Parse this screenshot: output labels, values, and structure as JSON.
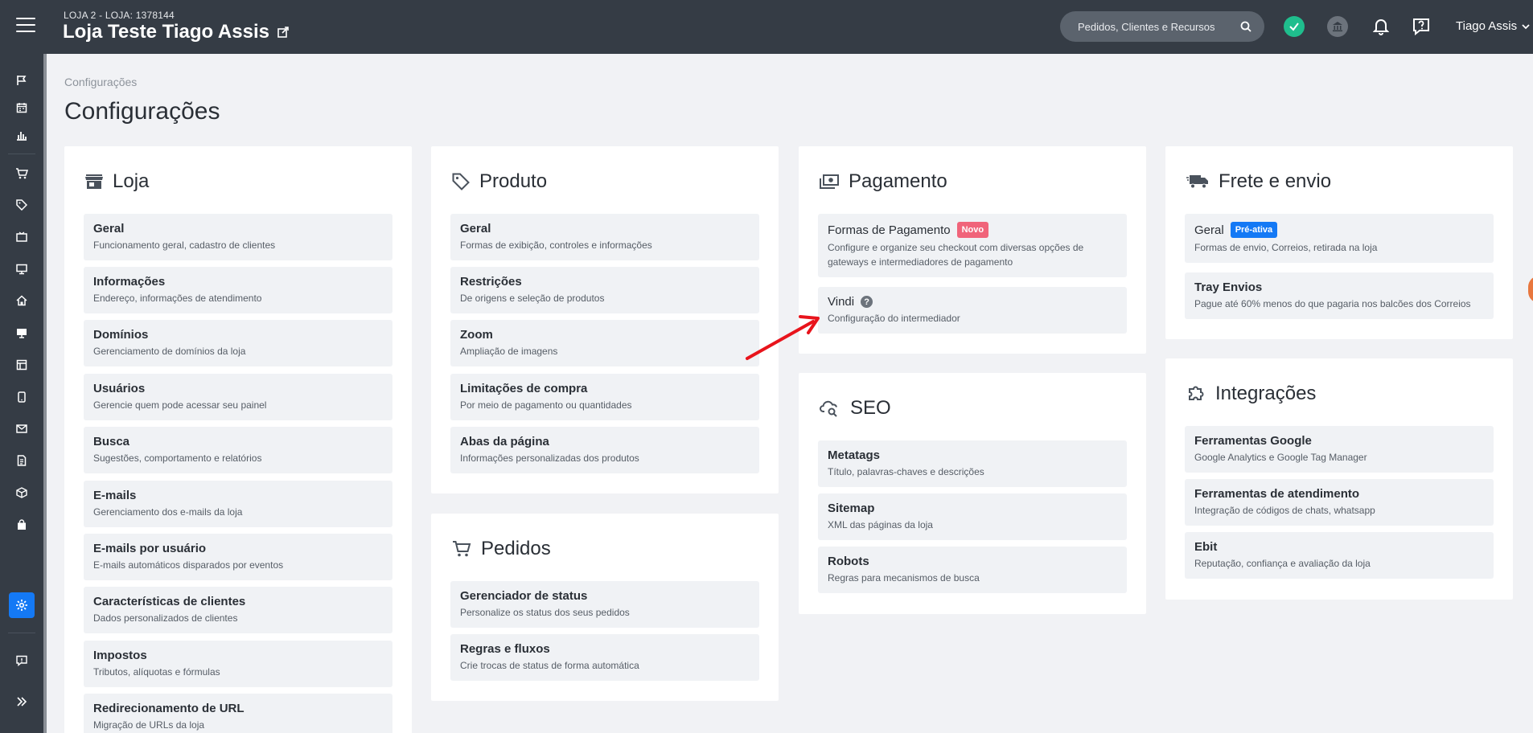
{
  "header": {
    "store_sub": "LOJA 2 - LOJA: 1378144",
    "store_title": "Loja Teste Tiago Assis",
    "search_placeholder": "Pedidos, Clientes e Recursos",
    "user_name": "Tiago Assis"
  },
  "sidebar": {
    "icons": [
      "flag-icon",
      "calendar-icon",
      "chart-icon",
      "cart-icon",
      "tag-icon",
      "tv-icon",
      "monitor-icon",
      "home-icon",
      "display-icon",
      "layout-icon",
      "mobile-icon",
      "mail-icon",
      "document-icon",
      "box-icon",
      "bag-icon",
      "gear-icon",
      "feedback-icon",
      "expand-icon"
    ],
    "active": "gear-icon"
  },
  "breadcrumb": "Configurações",
  "page_title": "Configurações",
  "cards": {
    "loja": {
      "title": "Loja",
      "items": [
        {
          "title": "Geral",
          "sub": "Funcionamento geral, cadastro de clientes"
        },
        {
          "title": "Informações",
          "sub": "Endereço, informações de atendimento"
        },
        {
          "title": "Domínios",
          "sub": "Gerenciamento de domínios da loja"
        },
        {
          "title": "Usuários",
          "sub": "Gerencie quem pode acessar seu painel"
        },
        {
          "title": "Busca",
          "sub": "Sugestões, comportamento e relatórios"
        },
        {
          "title": "E-mails",
          "sub": "Gerenciamento dos e-mails da loja"
        },
        {
          "title": "E-mails por usuário",
          "sub": "E-mails automáticos disparados por eventos"
        },
        {
          "title": "Características de clientes",
          "sub": "Dados personalizados de clientes"
        },
        {
          "title": "Impostos",
          "sub": "Tributos, alíquotas e fórmulas"
        },
        {
          "title": "Redirecionamento de URL",
          "sub": "Migração de URLs da loja"
        }
      ]
    },
    "produto": {
      "title": "Produto",
      "items": [
        {
          "title": "Geral",
          "sub": "Formas de exibição, controles e informações"
        },
        {
          "title": "Restrições",
          "sub": "De origens e seleção de produtos"
        },
        {
          "title": "Zoom",
          "sub": "Ampliação de imagens"
        },
        {
          "title": "Limitações de compra",
          "sub": "Por meio de pagamento ou quantidades"
        },
        {
          "title": "Abas da página",
          "sub": "Informações personalizadas dos produtos"
        }
      ]
    },
    "pedidos": {
      "title": "Pedidos",
      "items": [
        {
          "title": "Gerenciador de status",
          "sub": "Personalize os status dos seus pedidos"
        },
        {
          "title": "Regras e fluxos",
          "sub": "Crie trocas de status de forma automática"
        }
      ]
    },
    "pagamento": {
      "title": "Pagamento",
      "items": [
        {
          "title": "Formas de Pagamento",
          "badge": "Novo",
          "sub": "Configure e organize seu checkout com diversas opções de gateways e intermediadores de pagamento"
        },
        {
          "title": "Vindi",
          "help": "?",
          "sub": "Configuração do intermediador"
        }
      ]
    },
    "seo": {
      "title": "SEO",
      "items": [
        {
          "title": "Metatags",
          "sub": "Título, palavras-chaves e descrições"
        },
        {
          "title": "Sitemap",
          "sub": "XML das páginas da loja"
        },
        {
          "title": "Robots",
          "sub": "Regras para mecanismos de busca"
        }
      ]
    },
    "frete": {
      "title": "Frete e envio",
      "items": [
        {
          "title": "Geral",
          "badge": "Pré-ativa",
          "sub": "Formas de envio, Correios, retirada na loja"
        },
        {
          "title": "Tray Envios",
          "sub": "Pague até 60% menos do que pagaria nos balcões dos Correios"
        }
      ]
    },
    "integracoes": {
      "title": "Integrações",
      "items": [
        {
          "title": "Ferramentas Google",
          "sub": "Google Analytics e Google Tag Manager"
        },
        {
          "title": "Ferramentas de atendimento",
          "sub": "Integração de códigos de chats, whatsapp"
        },
        {
          "title": "Ebit",
          "sub": "Reputação, confiança e avaliação da loja"
        }
      ]
    }
  },
  "colors": {
    "topbar": "#353c45",
    "accent": "#1479f5",
    "badge_new": "#f0647a",
    "status_ok": "#1fbe8d",
    "annotation_arrow": "#e8141c"
  }
}
